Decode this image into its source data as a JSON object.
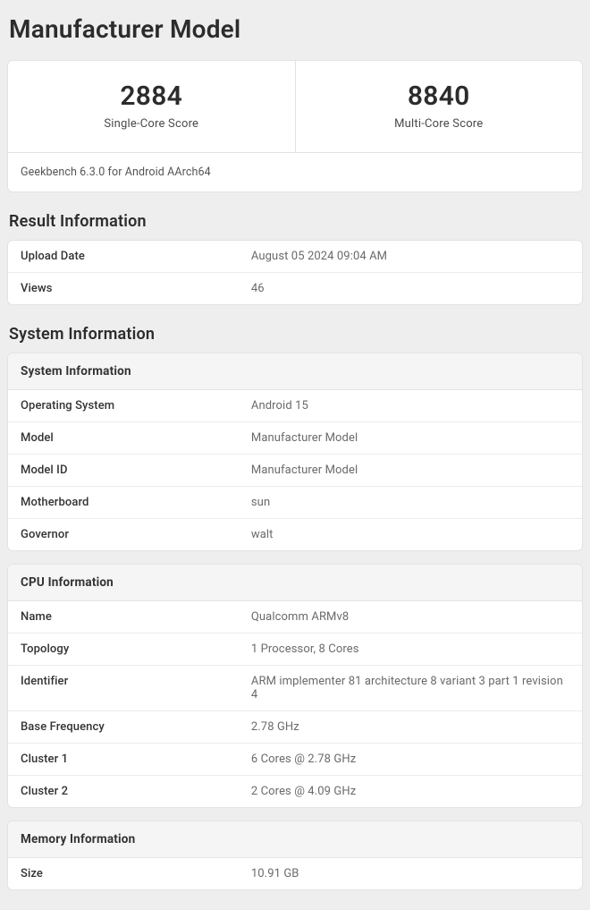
{
  "page_title": "Manufacturer Model",
  "scores": {
    "single": {
      "value": "2884",
      "label": "Single-Core Score"
    },
    "multi": {
      "value": "8840",
      "label": "Multi-Core Score"
    }
  },
  "benchmark_version": "Geekbench 6.3.0 for Android AArch64",
  "sections": {
    "result": {
      "title": "Result Information",
      "rows": [
        {
          "key": "Upload Date",
          "val": "August 05 2024 09:04 AM"
        },
        {
          "key": "Views",
          "val": "46"
        }
      ]
    },
    "system": {
      "title": "System Information",
      "groups": [
        {
          "header": "System Information",
          "rows": [
            {
              "key": "Operating System",
              "val": "Android 15"
            },
            {
              "key": "Model",
              "val": "Manufacturer Model"
            },
            {
              "key": "Model ID",
              "val": "Manufacturer Model"
            },
            {
              "key": "Motherboard",
              "val": "sun"
            },
            {
              "key": "Governor",
              "val": "walt"
            }
          ]
        },
        {
          "header": "CPU Information",
          "rows": [
            {
              "key": "Name",
              "val": "Qualcomm ARMv8"
            },
            {
              "key": "Topology",
              "val": "1 Processor, 8 Cores"
            },
            {
              "key": "Identifier",
              "val": "ARM implementer 81 architecture 8 variant 3 part 1 revision 4"
            },
            {
              "key": "Base Frequency",
              "val": "2.78 GHz"
            },
            {
              "key": "Cluster 1",
              "val": "6 Cores @ 2.78 GHz"
            },
            {
              "key": "Cluster 2",
              "val": "2 Cores @ 4.09 GHz"
            }
          ]
        },
        {
          "header": "Memory Information",
          "rows": [
            {
              "key": "Size",
              "val": "10.91 GB"
            }
          ]
        }
      ]
    }
  }
}
